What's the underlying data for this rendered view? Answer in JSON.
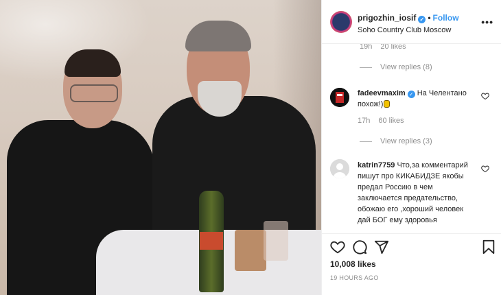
{
  "post": {
    "author": "prigozhin_iosif",
    "follow_label": "Follow",
    "location": "Soho Country Club Moscow",
    "more_icon": "more-icon",
    "likes": "10,008 likes",
    "time": "19 HOURS AGO"
  },
  "comments": [
    {
      "time": "19h",
      "likes": "20 likes",
      "view_replies": "View replies (8)"
    },
    {
      "user": "fadeevmaxim",
      "text": "На Челентано похож!)",
      "time": "17h",
      "likes": "60 likes",
      "view_replies": "View replies (3)"
    },
    {
      "user": "katrin7759",
      "text": "Что,за комментарий пишут про КИКАБИДЗЕ якобы предал Россию в чем заключается предательство, обожаю его ,хороший человек дай БОГ ему здоровья"
    }
  ],
  "colors": {
    "accent": "#3897f0",
    "text": "#262626",
    "muted": "#8e8e8e"
  }
}
